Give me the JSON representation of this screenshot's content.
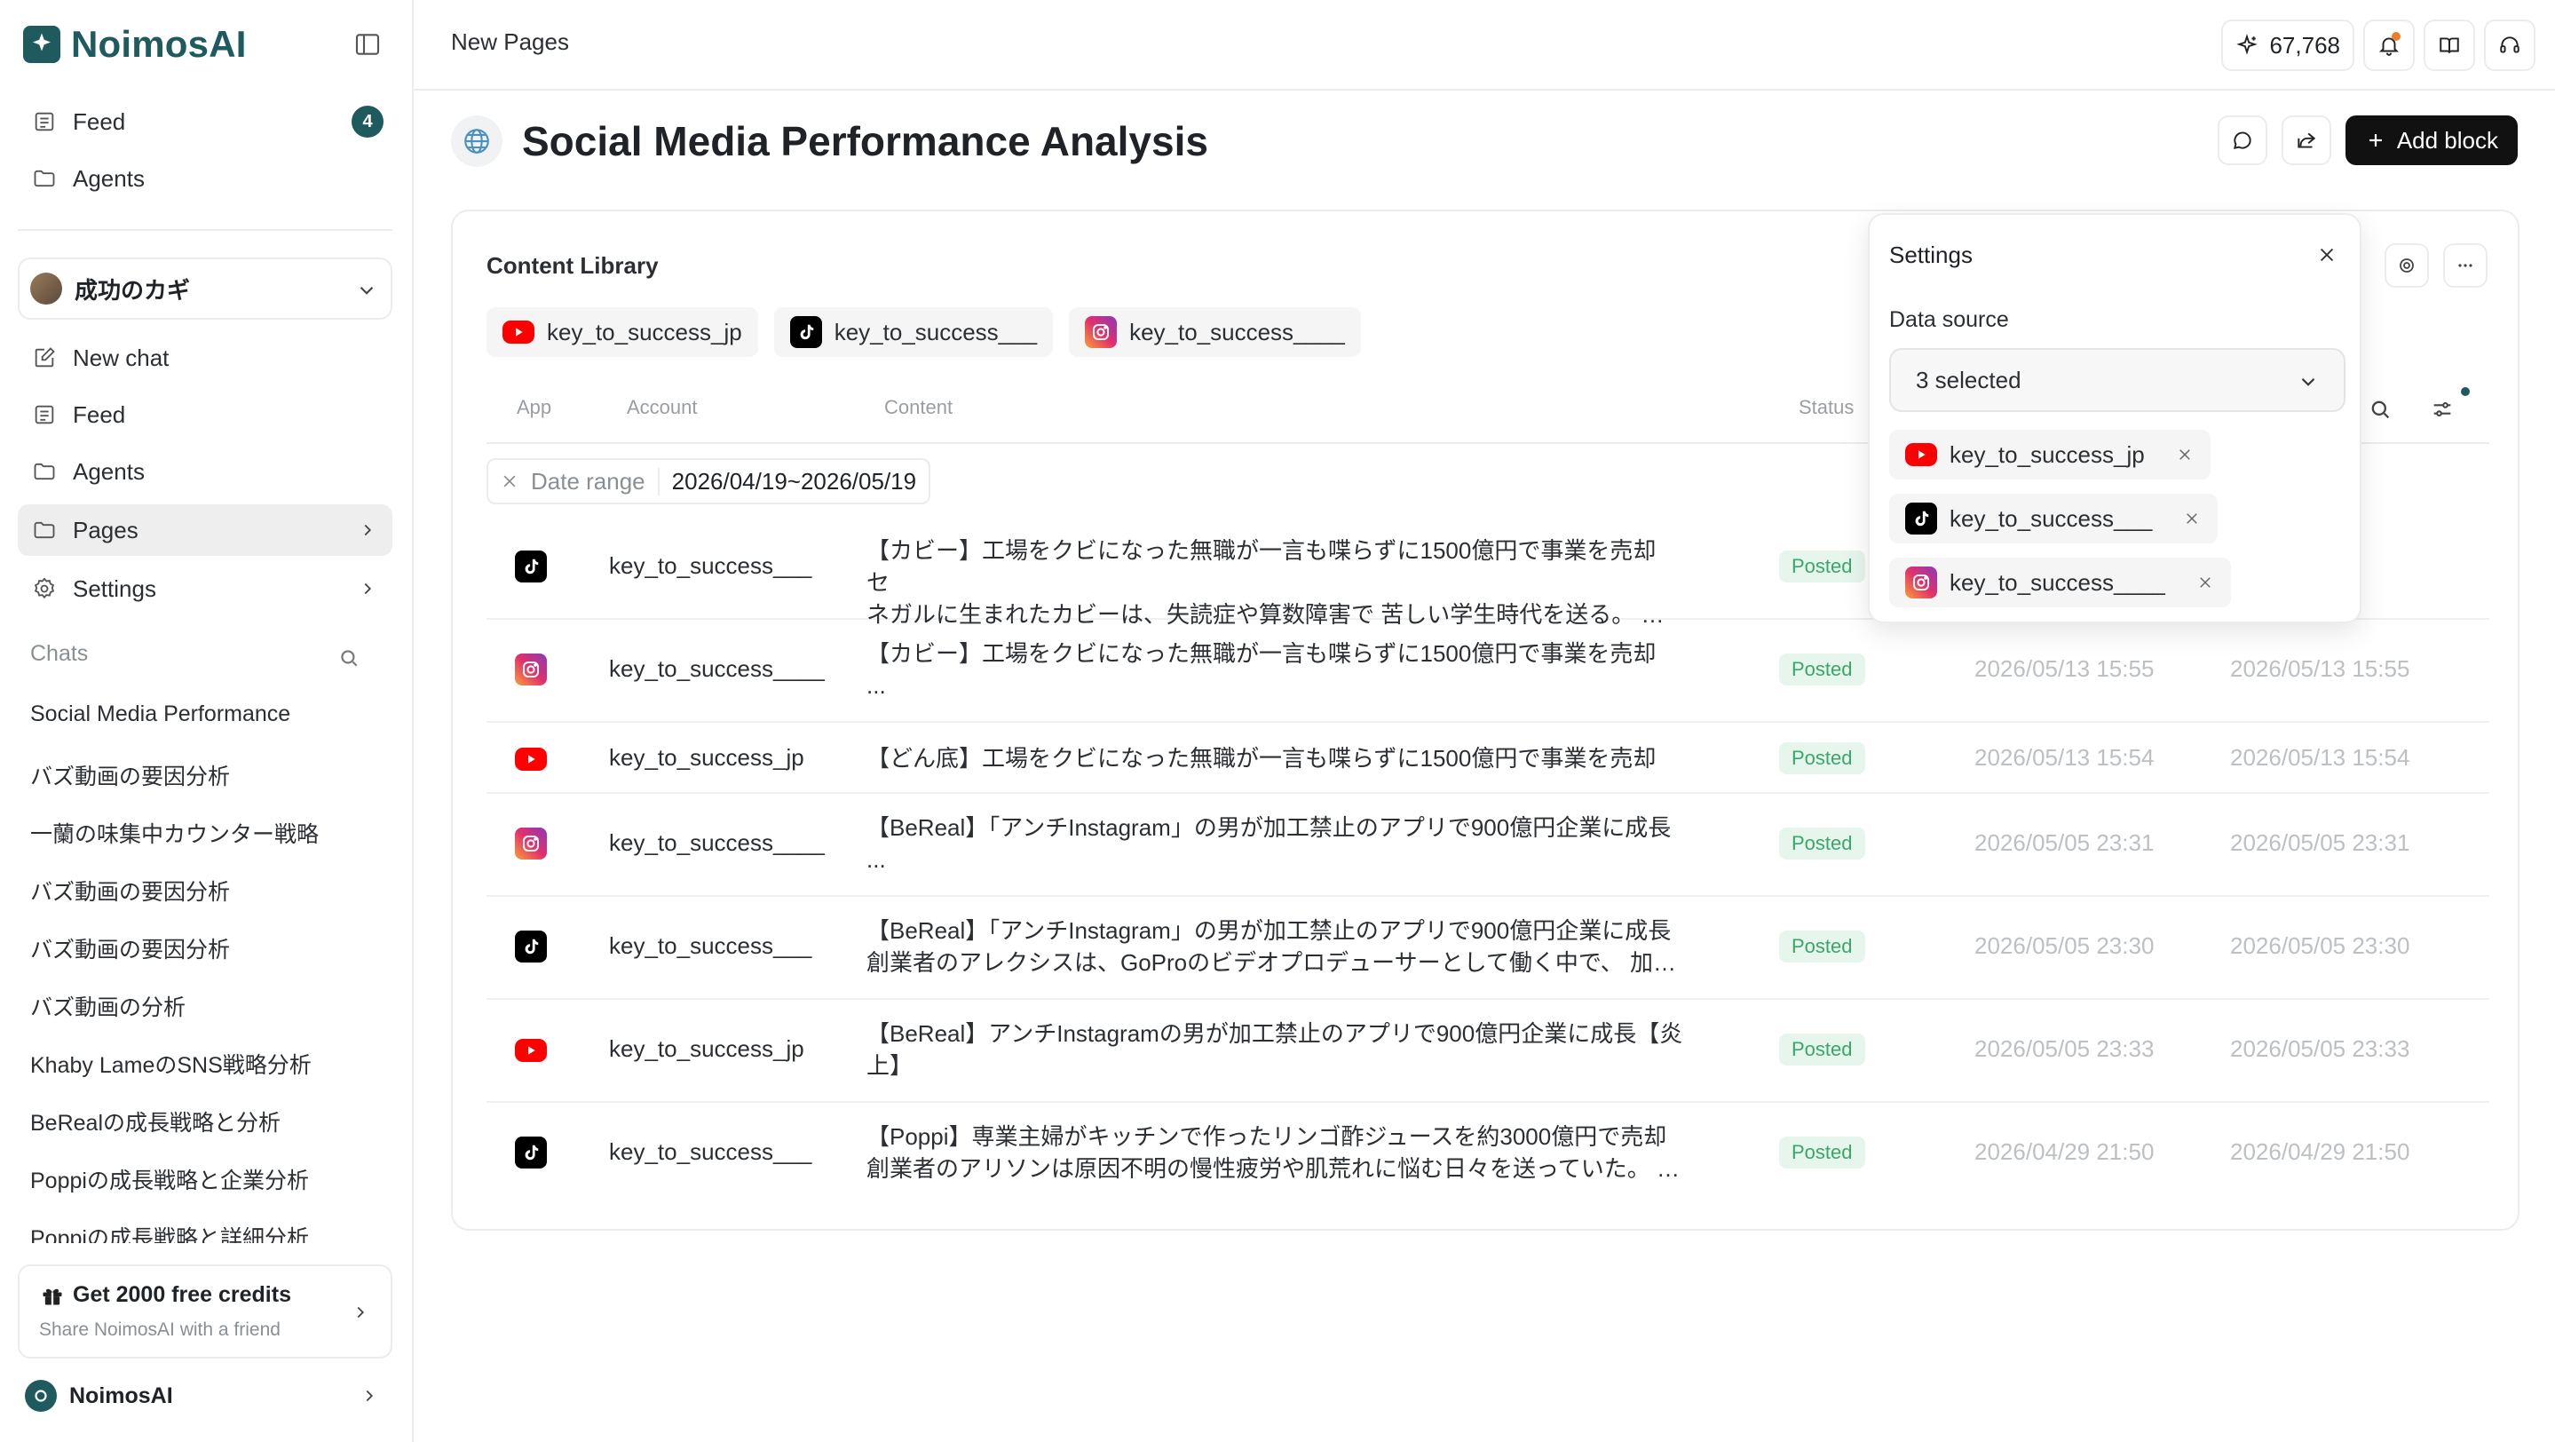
{
  "brand": {
    "name": "NoimosAI"
  },
  "sidebar": {
    "top_items": [
      {
        "label": "Feed",
        "badge": "4"
      },
      {
        "label": "Agents"
      }
    ],
    "workspace": {
      "name": "成功のカギ"
    },
    "items": [
      {
        "label": "New chat"
      },
      {
        "label": "Feed"
      },
      {
        "label": "Agents"
      },
      {
        "label": "Pages"
      },
      {
        "label": "Settings"
      }
    ],
    "chats_header": "Chats",
    "chats": [
      "Social Media Performance",
      "バズ動画の要因分析",
      "一蘭の味集中カウンター戦略",
      "バズ動画の要因分析",
      "バズ動画の要因分析",
      "バズ動画の分析",
      "Khaby LameのSNS戦略分析",
      "BeRealの成長戦略と分析",
      "Poppiの成長戦略と企業分析",
      "Poppiの成長戦略と詳細分析"
    ],
    "promo": {
      "title": "Get 2000 free credits",
      "subtitle": "Share NoimosAI with a friend"
    },
    "account": {
      "name": "NoimosAI"
    }
  },
  "topbar": {
    "breadcrumb": "New Pages",
    "credits": "67,768"
  },
  "page": {
    "title": "Social Media Performance Analysis",
    "add_block_label": "Add block"
  },
  "card": {
    "title": "Content Library",
    "chips": [
      {
        "app": "youtube",
        "label": "key_to_success_jp"
      },
      {
        "app": "tiktok",
        "label": "key_to_success___"
      },
      {
        "app": "instagram",
        "label": "key_to_success____"
      }
    ],
    "columns": {
      "app": "App",
      "account": "Account",
      "content": "Content",
      "status": "Status"
    },
    "date_range": {
      "label": "Date range",
      "value": "2026/04/19~2026/05/19"
    },
    "rows": [
      {
        "app": "tiktok",
        "account": "key_to_success___",
        "line1": "【カビー】工場をクビになった無職が一言も喋らずに1500億円で事業を売却 セ",
        "line2": "ネガルに生まれたカビーは、失読症や算数障害で 苦しい学生時代を送る。 コ...",
        "status": "Posted",
        "date1": "",
        "date2": ""
      },
      {
        "app": "instagram",
        "account": "key_to_success____",
        "line1": "【カビー】工場をクビになった無職が一言も喋らずに1500億円で事業を売却",
        "line2": "...",
        "status": "Posted",
        "date1": "2026/05/13 15:55",
        "date2": "2026/05/13 15:55"
      },
      {
        "app": "youtube",
        "account": "key_to_success_jp",
        "line1": "【どん底】工場をクビになった無職が一言も喋らずに1500億円で事業を売却",
        "line2": "",
        "status": "Posted",
        "date1": "2026/05/13 15:54",
        "date2": "2026/05/13 15:54"
      },
      {
        "app": "instagram",
        "account": "key_to_success____",
        "line1": "【BeReal】「アンチInstagram」の男が加工禁止のアプリで900億円企業に成長",
        "line2": "...",
        "status": "Posted",
        "date1": "2026/05/05 23:31",
        "date2": "2026/05/05 23:31"
      },
      {
        "app": "tiktok",
        "account": "key_to_success___",
        "line1": "【BeReal】「アンチInstagram」の男が加工禁止のアプリで900億円企業に成長",
        "line2": "創業者のアレクシスは、GoProのビデオプロデューサーとして働く中で、 加工...",
        "status": "Posted",
        "date1": "2026/05/05 23:30",
        "date2": "2026/05/05 23:30"
      },
      {
        "app": "youtube",
        "account": "key_to_success_jp",
        "line1": "【BeReal】アンチInstagramの男が加工禁止のアプリで900億円企業に成長【炎",
        "line2": "上】",
        "status": "Posted",
        "date1": "2026/05/05 23:33",
        "date2": "2026/05/05 23:33"
      },
      {
        "app": "tiktok",
        "account": "key_to_success___",
        "line1": "【Poppi】専業主婦がキッチンで作ったリンゴ酢ジュースを約3000億円で売却",
        "line2": "創業者のアリソンは原因不明の慢性疲労や肌荒れに悩む日々を送っていた。 リ...",
        "status": "Posted",
        "date1": "2026/04/29 21:50",
        "date2": "2026/04/29 21:50"
      }
    ]
  },
  "settings_popover": {
    "title": "Settings",
    "data_source_label": "Data source",
    "selected_text": "3 selected",
    "tags": [
      {
        "app": "youtube",
        "label": "key_to_success_jp"
      },
      {
        "app": "tiktok",
        "label": "key_to_success___"
      },
      {
        "app": "instagram",
        "label": "key_to_success____"
      }
    ]
  },
  "colors": {
    "brand": "#1f5b5e",
    "status_green": "#3aa66a",
    "notification": "#f07b2b"
  }
}
